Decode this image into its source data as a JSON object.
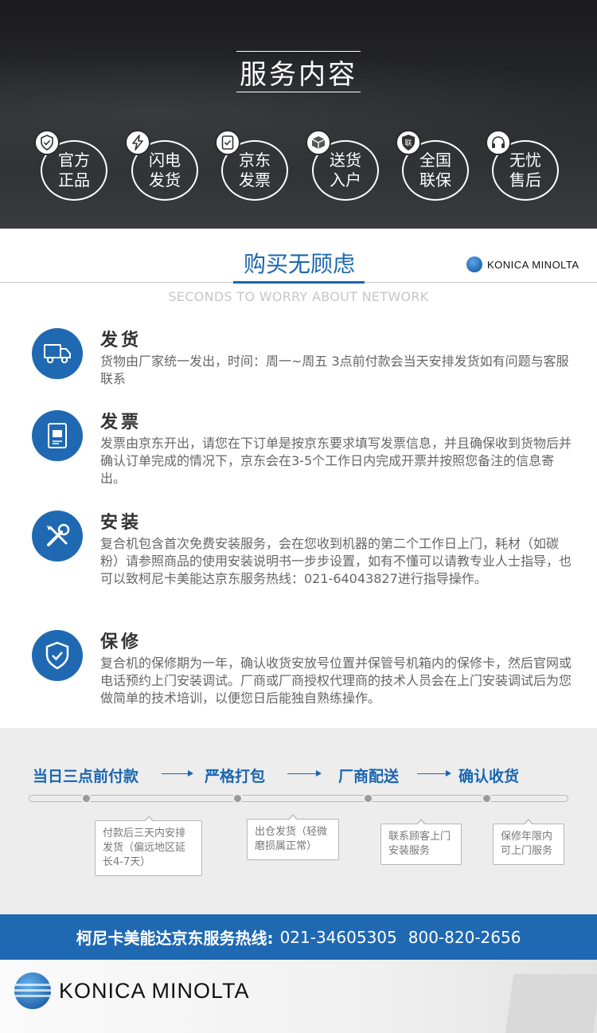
{
  "banner": {
    "title": "服务内容",
    "badges": [
      {
        "line1": "官方",
        "line2": "正品",
        "icon": "shield-check-icon"
      },
      {
        "line1": "闪电",
        "line2": "发货",
        "icon": "lightning-icon"
      },
      {
        "line1": "京东",
        "line2": "发票",
        "icon": "invoice-check-icon"
      },
      {
        "line1": "送货",
        "line2": "入户",
        "icon": "package-icon"
      },
      {
        "line1": "全国",
        "line2": "联保",
        "icon": "shield-lian-icon"
      },
      {
        "line1": "无忧",
        "line2": "售后",
        "icon": "headset-icon"
      }
    ],
    "badge_icon_glyph_lian": "联"
  },
  "section": {
    "title": "购买无顾虑",
    "subtitle": "SECONDS TO WORRY ABOUT NETWORK",
    "brand": "KONICA MINOLTA"
  },
  "features": [
    {
      "title": "发货",
      "icon": "truck-icon",
      "desc": "货物由厂家统一发出，时间：周一~周五 3点前付款会当天安排发货如有问题与客服联系"
    },
    {
      "title": "发票",
      "icon": "invoice-icon",
      "desc": "发票由京东开出，请您在下订单是按京东要求填写发票信息，并且确保收到货物后并确认订单完成的情况下，京东会在3-5个工作日内完成开票并按照您备注的信息寄出。"
    },
    {
      "title": "安装",
      "icon": "tools-icon",
      "desc": "复合机包含首次免费安装服务，会在您收到机器的第二个工作日上门，耗材（如碳粉）请参照商品的使用安装说明书一步步设置，如有不懂可以请教专业人士指导，也可以致柯尼卡美能达京东服务热线：021-64043827进行指导操作。"
    },
    {
      "title": "保修",
      "icon": "shield-check-icon",
      "desc": "复合机的保修期为一年，确认收货安放号位置并保管号机箱内的保修卡，然后官网或电话预约上门安装调试。厂商或厂商授权代理商的技术人员会在上门安装调试后为您做简单的技术培训，以便您日后能独自熟练操作。"
    }
  ],
  "process": {
    "steps": [
      "当日三点前付款",
      "严格打包",
      "厂商配送",
      "确认收货"
    ],
    "notes": [
      {
        "lines": [
          "付款后三天内安排",
          "发货（偏远地区延",
          "长4-7天）"
        ]
      },
      {
        "lines": [
          "出仓发货（轻微",
          "磨损属正常）"
        ]
      },
      {
        "lines": [
          "联系顾客上门",
          "安装服务"
        ]
      },
      {
        "lines": [
          "保修年限内",
          "可上门服务"
        ]
      }
    ]
  },
  "hotline": {
    "label": "柯尼卡美能达京东服务热线:",
    "phone1": "021-34605305",
    "phone2": "800-820-2656"
  },
  "footer": {
    "brand": "KONICA MINOLTA"
  },
  "colors": {
    "accent": "#1f69b3",
    "banner_bg": "#2b2c2f",
    "process_bg": "#ededed"
  }
}
